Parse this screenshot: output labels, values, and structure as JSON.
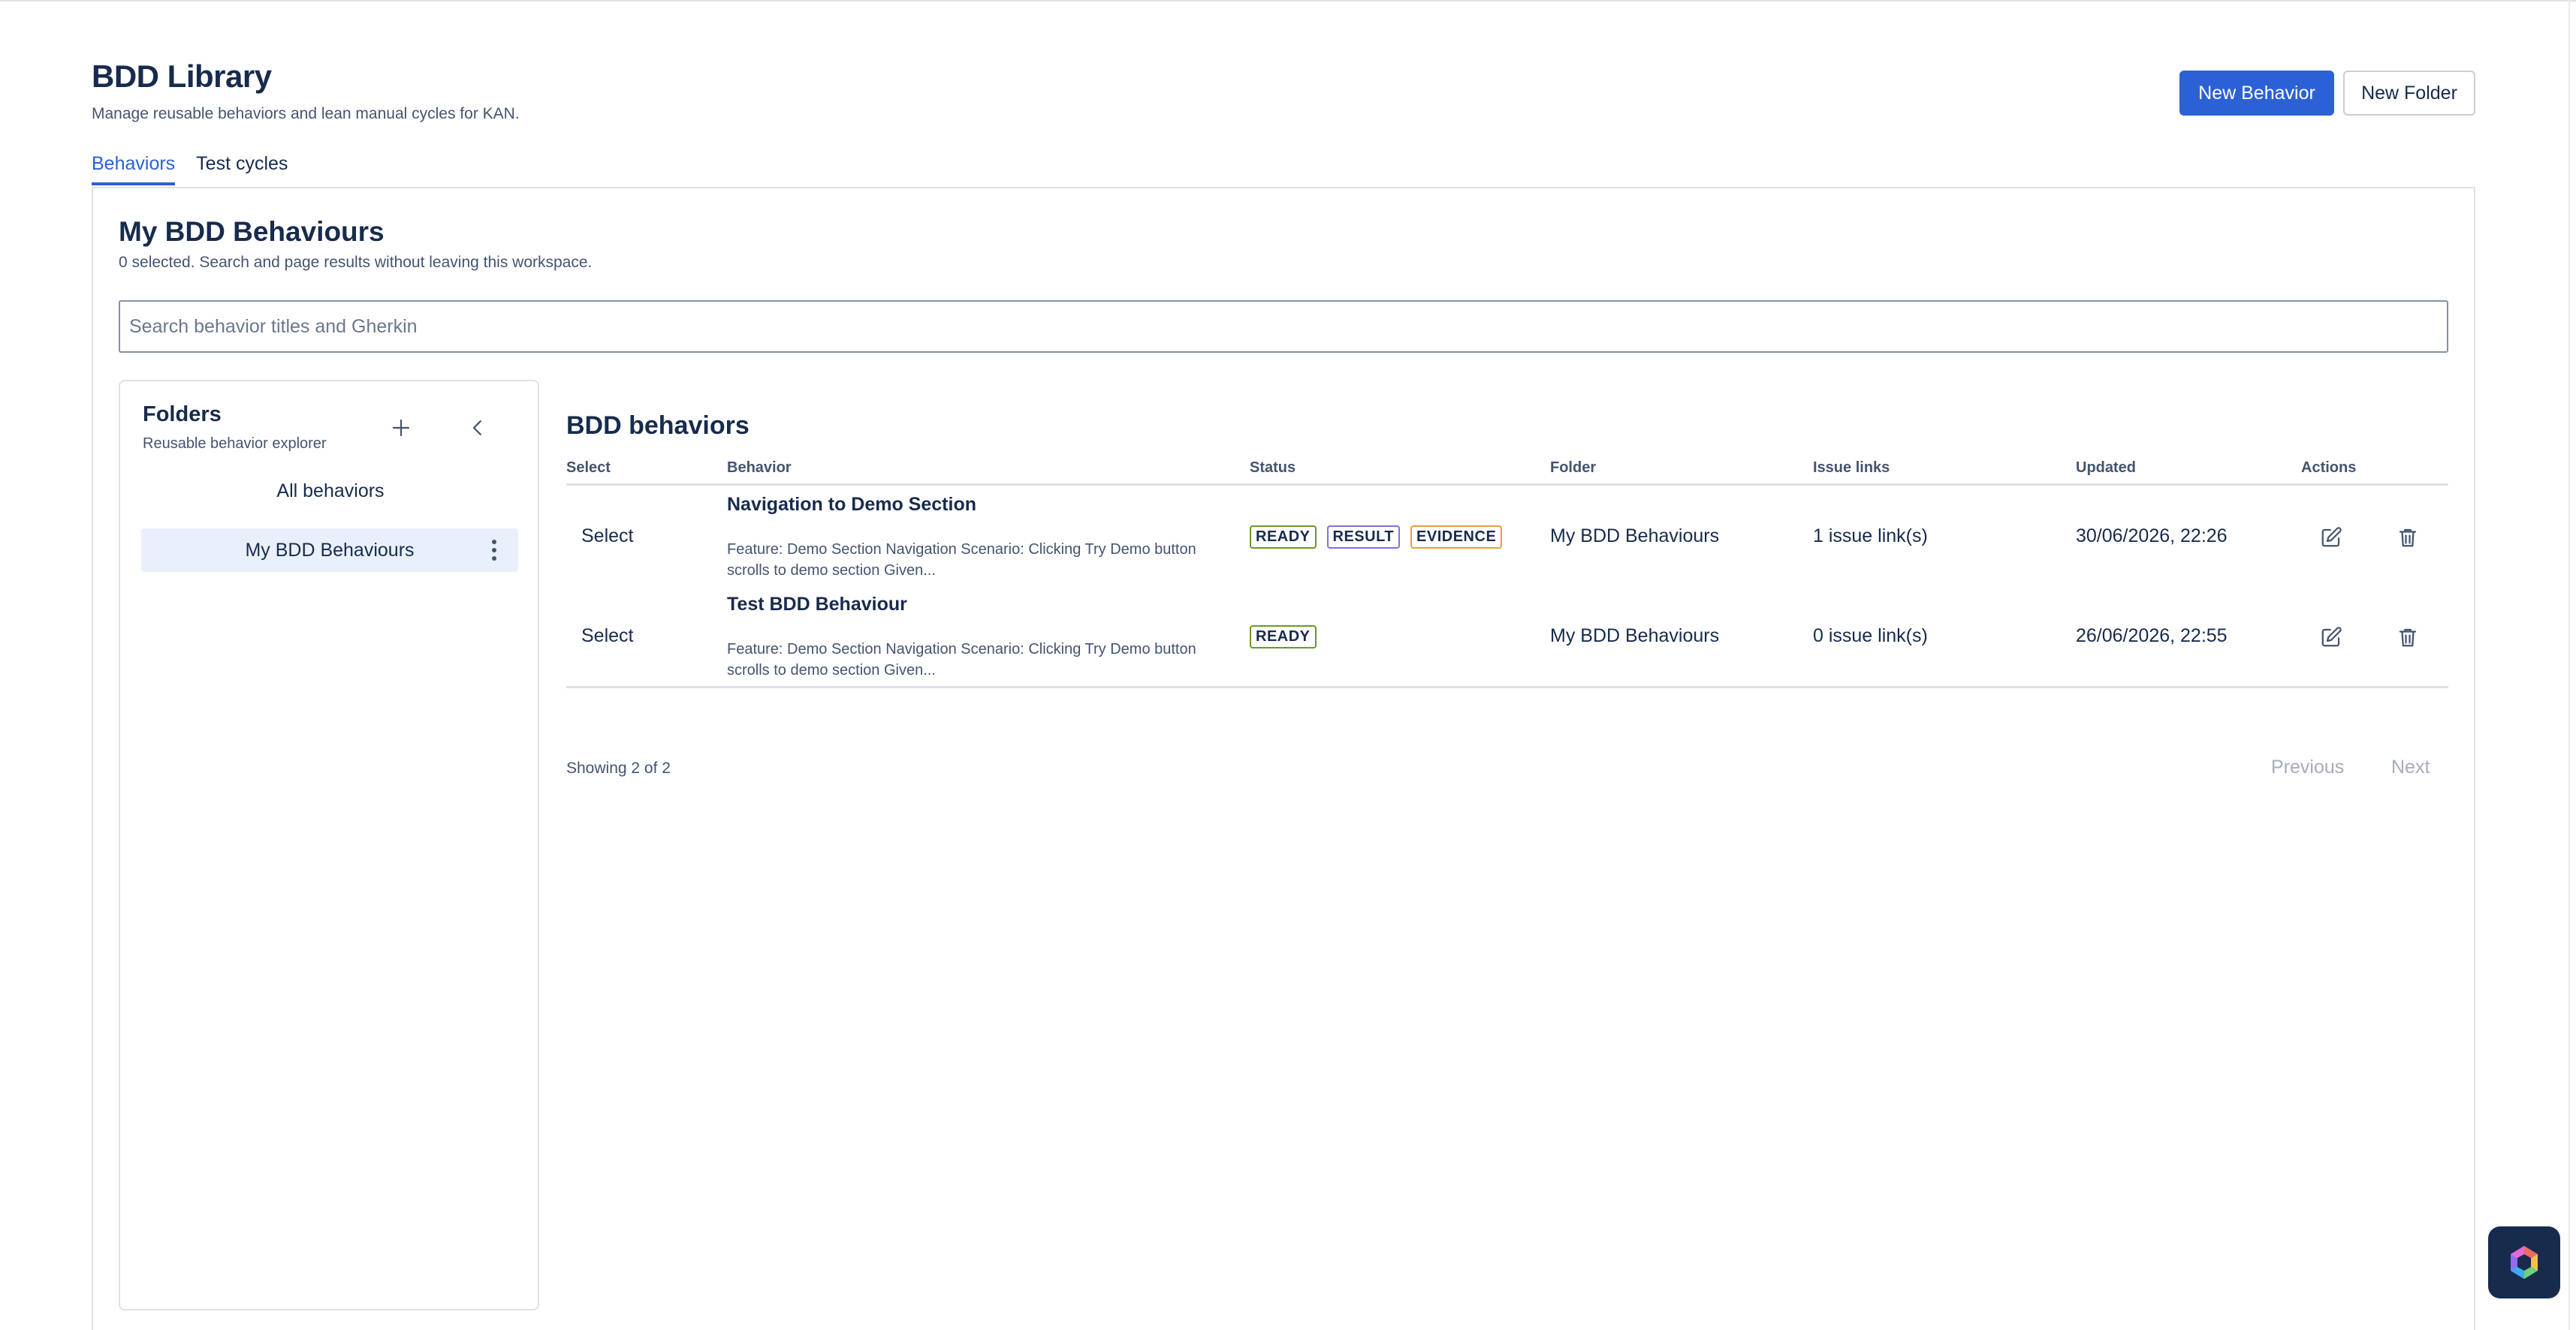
{
  "app": {
    "title": "BDD Library",
    "subtitle": "Manage reusable behaviors and lean manual cycles for KAN."
  },
  "toolbar": {
    "new_behavior_label": "New Behavior",
    "new_folder_label": "New Folder"
  },
  "tabs": [
    {
      "label": "Behaviors",
      "active": true
    },
    {
      "label": "Test cycles",
      "active": false
    }
  ],
  "workspace": {
    "title": "My BDD Behaviours",
    "subtitle": "0 selected. Search and page results without leaving this workspace."
  },
  "search": {
    "placeholder": "Search behavior titles and Gherkin",
    "value": ""
  },
  "folders": {
    "title": "Folders",
    "subtitle": "Reusable behavior explorer",
    "add_icon": "plus-icon",
    "collapse_icon": "chevron-left-icon",
    "all_label": "All behaviors",
    "items": [
      {
        "label": "My BDD Behaviours",
        "selected": true,
        "menu_icon": "more-vertical-icon"
      }
    ]
  },
  "table": {
    "title": "BDD behaviors",
    "columns": [
      "Select",
      "Behavior",
      "Status",
      "Folder",
      "Issue links",
      "Updated",
      "Actions"
    ],
    "rows": [
      {
        "select_label": "Select",
        "name": "Navigation to Demo Section",
        "description": "Feature: Demo Section Navigation Scenario: Clicking Try Demo button scrolls to demo section Given...",
        "badges": [
          "READY",
          "RESULT",
          "EVIDENCE"
        ],
        "folder": "My BDD Behaviours",
        "issue_links": "1 issue link(s)",
        "updated": "30/06/2026, 22:26",
        "edit_icon": "edit-icon",
        "delete_icon": "trash-icon"
      },
      {
        "select_label": "Select",
        "name": "Test BDD Behaviour",
        "description": "Feature: Demo Section Navigation Scenario: Clicking Try Demo button scrolls to demo section Given...",
        "badges": [
          "READY"
        ],
        "folder": "My BDD Behaviours",
        "issue_links": "0 issue link(s)",
        "updated": "26/06/2026, 22:55",
        "edit_icon": "edit-icon",
        "delete_icon": "trash-icon"
      }
    ]
  },
  "pagination": {
    "showing": "Showing 2 of 2",
    "previous_label": "Previous",
    "next_label": "Next"
  },
  "colors": {
    "accent": "#2c61d6",
    "ready": "#6a9a23",
    "result": "#8270db",
    "evidence": "#e2a03f",
    "selected_folder_bg": "#e9f0fc"
  },
  "widget": {
    "icon": "assistant-hexagon-icon"
  }
}
